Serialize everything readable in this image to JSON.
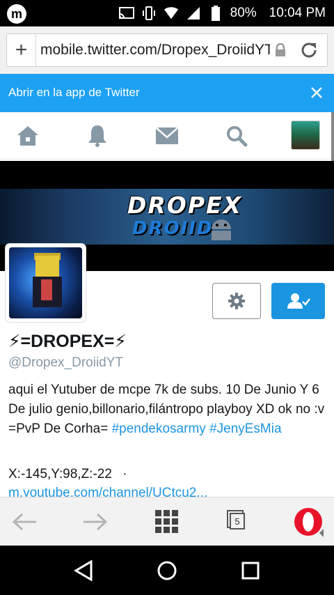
{
  "status_bar": {
    "battery": "80%",
    "time": "10:04 PM"
  },
  "address_bar": {
    "url": "mobile.twitter.com/Dropex_DroiidYT"
  },
  "app_banner": {
    "text": "Abrir en la app de Twitter"
  },
  "header_image": {
    "logo_line1": "DROPEX",
    "logo_line2": "DROIID"
  },
  "profile": {
    "display_name": "⚡=DROPEX=⚡",
    "handle": "@Dropex_DroiidYT",
    "bio_text": "aqui el Yutuber de mcpe 7k de subs. 10 De Junio Y 6 De julio genio,billonario,filántropo playboy XD ok no :v =PvP De Corha=",
    "bio_hashtag1": "#pendekosarmy",
    "bio_hashtag2": "#JenyEsMia",
    "location": "X:-145,Y:98,Z:-22",
    "separator": "·",
    "website": "m.youtube.com/channel/UCtcu2..."
  },
  "browser_toolbar": {
    "tab_count": "5"
  },
  "colors": {
    "twitter_blue": "#1da1f2",
    "link_blue": "#1b95e0",
    "opera_red": "#e8132a"
  }
}
